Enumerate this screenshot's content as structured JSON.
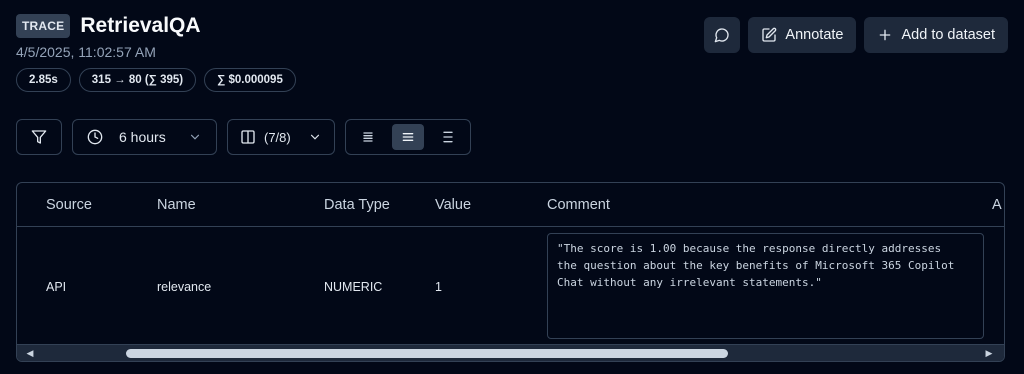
{
  "header": {
    "badge": "TRACE",
    "title": "RetrievalQA",
    "timestamp": "4/5/2025, 11:02:57 AM",
    "pills": [
      "2.85s",
      "315 → 80 (∑ 395)",
      "∑ $0.000095"
    ]
  },
  "actions": {
    "comment_icon": "message-circle-icon",
    "annotate_label": "Annotate",
    "add_dataset_label": "Add to dataset"
  },
  "toolbar": {
    "time_range": "6 hours",
    "columns": "(7/8)",
    "density_options": [
      "compact",
      "default",
      "spacious"
    ],
    "density_selected": "default"
  },
  "table": {
    "columns": [
      "Source",
      "Name",
      "Data Type",
      "Value",
      "Comment",
      "A"
    ],
    "rows": [
      {
        "source": "API",
        "name": "relevance",
        "data_type": "NUMERIC",
        "value": "1",
        "comment": "\"The score is 1.00 because the response directly addresses\nthe question about the key benefits of Microsoft 365 Copilot\nChat without any irrelevant statements.\""
      }
    ],
    "scroll_position": 0.25,
    "scroll_visible_fraction": 0.64
  },
  "colors": {
    "background": "#020817",
    "border": "#334155",
    "button_bg": "#1e293b",
    "text": "#f1f5f9",
    "muted": "#94a3b8"
  }
}
